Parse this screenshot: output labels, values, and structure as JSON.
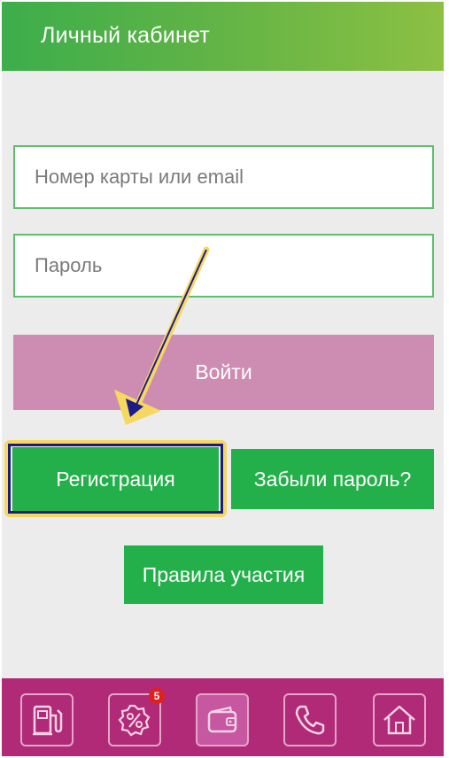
{
  "header": {
    "title": "Личный кабинет"
  },
  "form": {
    "login_placeholder": "Номер карты или email",
    "password_placeholder": "Пароль",
    "login_button": "Войти",
    "register_button": "Регистрация",
    "forgot_button": "Забыли пароль?",
    "rules_button": "Правила участия"
  },
  "tabbar": {
    "items": [
      {
        "icon": "fuel-pump-icon"
      },
      {
        "icon": "percent-badge-icon",
        "badge": "5"
      },
      {
        "icon": "wallet-icon"
      },
      {
        "icon": "phone-icon"
      },
      {
        "icon": "home-icon"
      }
    ]
  },
  "colors": {
    "header_start": "#3cae4b",
    "header_end": "#8cc043",
    "primary_green": "#23b04a",
    "login_button": "#cd8db2",
    "tabbar": "#b02a77",
    "highlight": "#f6d860"
  }
}
